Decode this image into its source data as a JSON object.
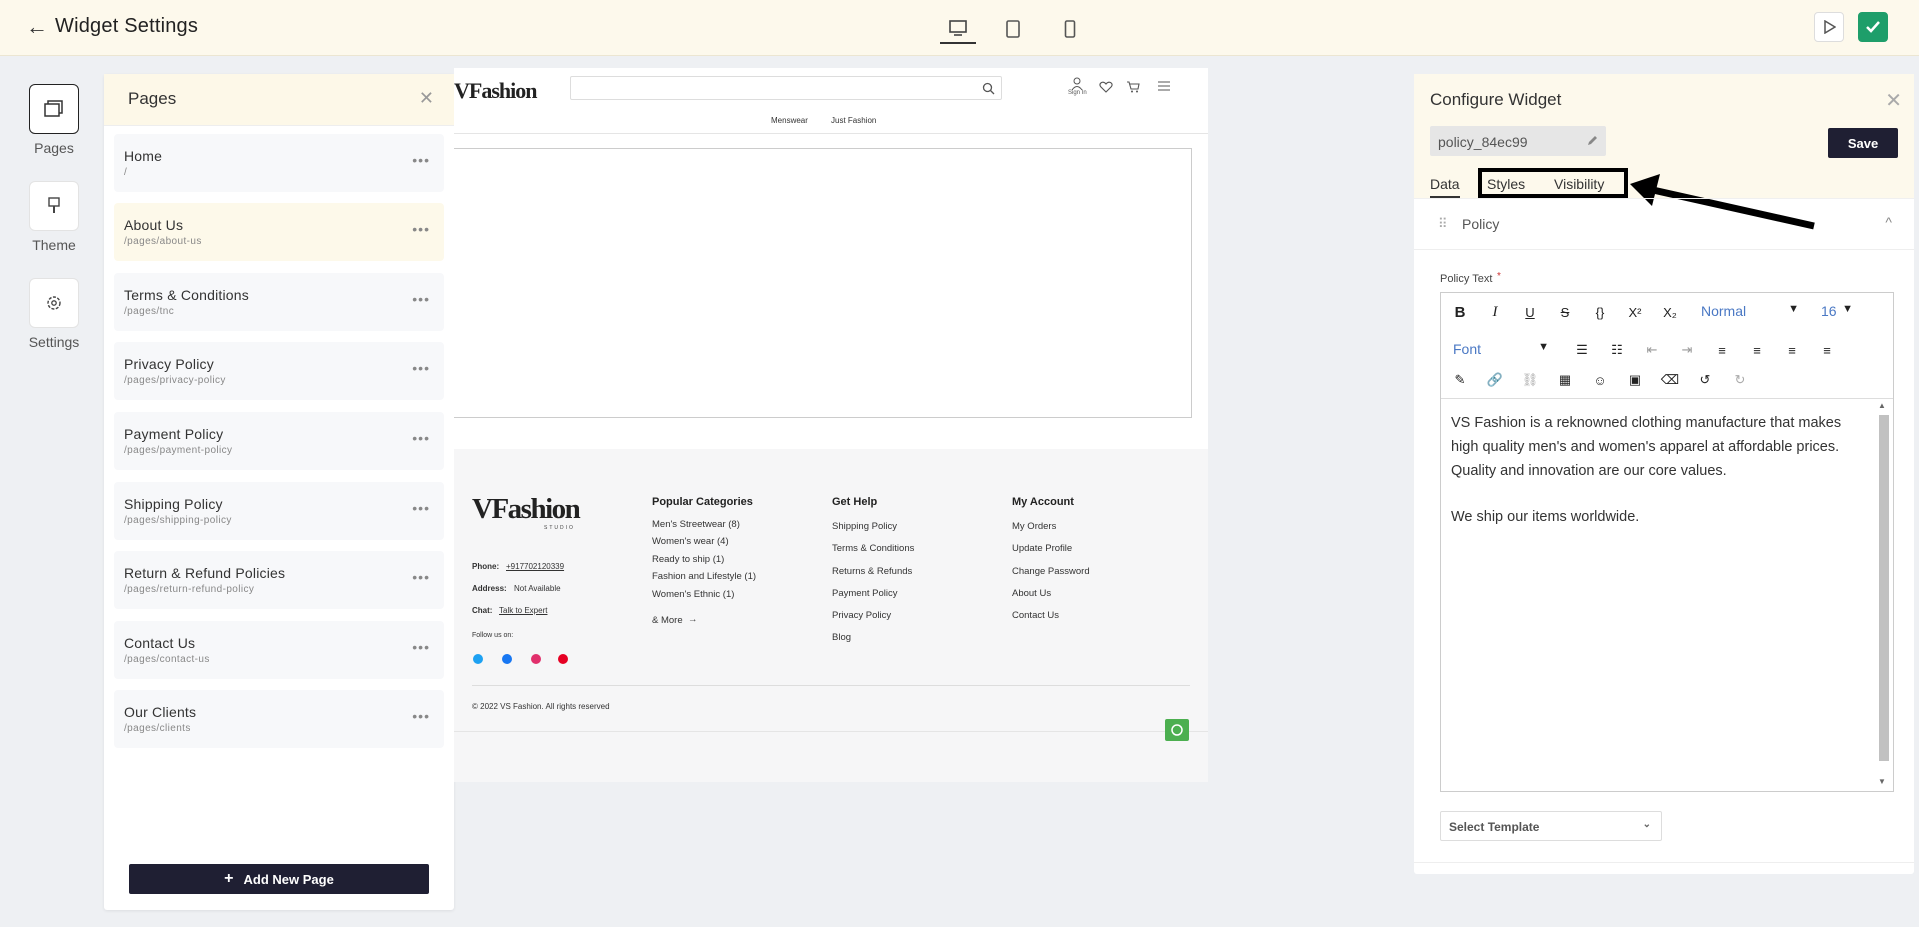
{
  "topbar": {
    "title": "Widget Settings"
  },
  "rail": {
    "items": [
      {
        "label": "Pages"
      },
      {
        "label": "Theme"
      },
      {
        "label": "Settings"
      }
    ]
  },
  "pages_panel": {
    "title": "Pages",
    "items": [
      {
        "name": "Home",
        "path": "/"
      },
      {
        "name": "About Us",
        "path": "/pages/about-us"
      },
      {
        "name": "Terms & Conditions",
        "path": "/pages/tnc"
      },
      {
        "name": "Privacy Policy",
        "path": "/pages/privacy-policy"
      },
      {
        "name": "Payment Policy",
        "path": "/pages/payment-policy"
      },
      {
        "name": "Shipping Policy",
        "path": "/pages/shipping-policy"
      },
      {
        "name": "Return & Refund Policies",
        "path": "/pages/return-refund-policy"
      },
      {
        "name": "Contact Us",
        "path": "/pages/contact-us"
      },
      {
        "name": "Our Clients",
        "path": "/pages/clients"
      }
    ],
    "add_label": "Add New Page"
  },
  "preview": {
    "logo": "VFashion",
    "logo_sub": "STUDIO",
    "sign_in": "Sign In",
    "nav": [
      "Menswear",
      "Just Fashion"
    ],
    "footer": {
      "logo": "VFashion",
      "logo_sub": "STUDIO",
      "phone_label": "Phone:",
      "phone": "+917702120339",
      "address_label": "Address:",
      "address": "Not Available",
      "chat_label": "Chat:",
      "chat": "Talk to Expert",
      "follow": "Follow us on:",
      "col1_title": "Popular Categories",
      "col1": [
        "Men's Streetwear (8)",
        "Women's wear (4)",
        "Ready to ship (1)",
        "Fashion and Lifestyle (1)",
        "Women's Ethnic (1)"
      ],
      "more": "& More",
      "col2_title": "Get Help",
      "col2": [
        "Shipping Policy",
        "Terms & Conditions",
        "Returns & Refunds",
        "Payment Policy",
        "Privacy Policy",
        "Blog"
      ],
      "col3_title": "My Account",
      "col3": [
        "My Orders",
        "Update Profile",
        "Change Password",
        "About Us",
        "Contact Us"
      ],
      "copyright": "© 2022 VS Fashion. All rights reserved"
    }
  },
  "configure": {
    "title": "Configure Widget",
    "widget_name": "policy_84ec99",
    "save_label": "Save",
    "tabs": [
      "Data",
      "Styles",
      "Visibility"
    ],
    "section": "Policy",
    "field_label": "Policy Text",
    "required_mark": "*",
    "format_select": "Normal",
    "size_select": "16",
    "font_select": "Font",
    "text_p1": "VS Fashion is a reknowned clothing manufacture that makes high quality men's and women's apparel at affordable prices. Quality and innovation are our core values.",
    "text_p2": "We ship our items worldwide.",
    "template_placeholder": "Select Template"
  },
  "colors": {
    "accent": "#1f1f33",
    "header_bg": "#fdf9ec",
    "whatsapp": "#4caf50"
  }
}
